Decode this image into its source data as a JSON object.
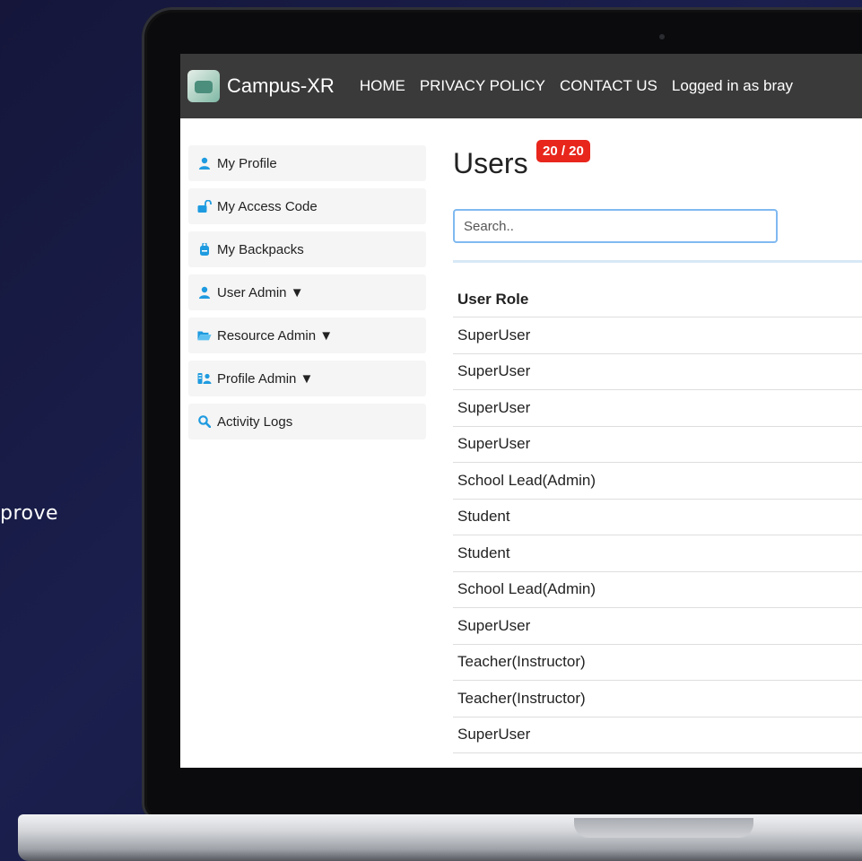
{
  "side_text": "prove",
  "navbar": {
    "brand": "Campus-XR",
    "links": [
      {
        "label": "HOME"
      },
      {
        "label": "PRIVACY POLICY"
      },
      {
        "label": "CONTACT US"
      }
    ],
    "user_text": "Logged in as bray"
  },
  "sidebar": {
    "items": [
      {
        "label": "My Profile",
        "icon": "user-icon",
        "color": "#1e9be0"
      },
      {
        "label": "My Access Code",
        "icon": "unlock-icon",
        "color": "#1e9be0"
      },
      {
        "label": "My Backpacks",
        "icon": "backpack-icon",
        "color": "#1e9be0"
      },
      {
        "label": "User Admin ▼",
        "icon": "user-icon",
        "color": "#1e9be0"
      },
      {
        "label": "Resource Admin ▼",
        "icon": "folder-open-icon",
        "color": "#1e9be0"
      },
      {
        "label": "Profile Admin ▼",
        "icon": "profiles-icon",
        "color": "#1e9be0"
      },
      {
        "label": "Activity Logs",
        "icon": "magnifier-icon",
        "color": "#1e9be0"
      }
    ]
  },
  "main": {
    "title": "Users",
    "count_badge": "20 / 20",
    "search_placeholder": "Search..",
    "table": {
      "header": "User Role",
      "rows": [
        "SuperUser",
        "SuperUser",
        "SuperUser",
        "SuperUser",
        "School Lead(Admin)",
        "Student",
        "Student",
        "School Lead(Admin)",
        "SuperUser",
        "Teacher(Instructor)",
        "Teacher(Instructor)",
        "SuperUser"
      ]
    }
  },
  "colors": {
    "navbar_bg": "#3b3a3a",
    "badge_bg": "#e8261c",
    "accent": "#1e9be0",
    "search_border": "#80b9f1"
  }
}
